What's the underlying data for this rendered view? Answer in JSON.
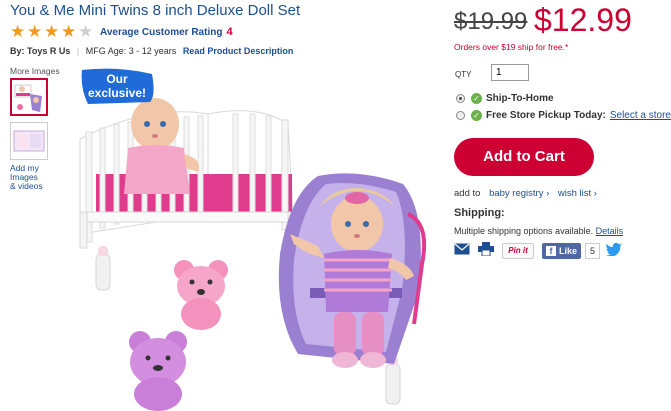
{
  "product": {
    "title": "You & Me Mini Twins 8 inch Deluxe Doll Set",
    "rating_stars": 4,
    "rating_max": 5,
    "avg_rating_label": "Average Customer Rating",
    "avg_rating_value": "4",
    "by_prefix": "By:",
    "brand": "Toys R Us",
    "mfg_age": "MFG Age: 3 - 12 years",
    "read_description": "Read Product Description"
  },
  "gallery": {
    "more_images_label": "More Images",
    "add_media_label": [
      "Add my",
      "Images",
      "& videos"
    ],
    "badge_line1": "Our",
    "badge_line2": "exclusive!"
  },
  "pricing": {
    "old_price": "$19.99",
    "new_price": "$12.99",
    "ship_note": "Orders over $19 ship for free.*"
  },
  "purchase": {
    "qty_label": "QTY",
    "qty_value": "1",
    "option_ship": "Ship-To-Home",
    "option_pickup": "Free Store Pickup Today:",
    "select_store": "Select a store",
    "add_to_cart": "Add to Cart",
    "add_to_prefix": "add to",
    "baby_registry": "baby registry ›",
    "wish_list": "wish list ›"
  },
  "shipping": {
    "heading": "Shipping:",
    "note": "Multiple shipping options available.",
    "details_link": "Details"
  },
  "social": {
    "pinit": "Pin it",
    "fb_like": "Like",
    "fb_count": "5"
  },
  "colors": {
    "accent_red": "#cc0033",
    "link_blue": "#1d4f91",
    "star_orange": "#f39a1d",
    "badge_blue": "#1f6bd8",
    "crib_pink": "#e03c8e",
    "seat_purple": "#9b7fd0"
  }
}
